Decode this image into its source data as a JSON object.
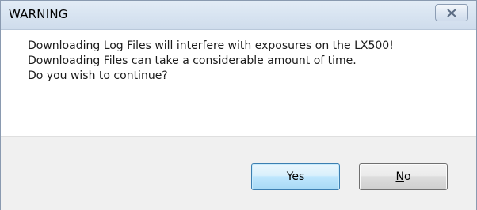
{
  "dialog": {
    "title": "WARNING",
    "message_lines": [
      "Downloading Log Files will interfere with exposures on the LX500!",
      "Downloading Files can take a considerable amount of time.",
      "Do you wish to continue?"
    ],
    "close_icon": "close-x-icon",
    "buttons": {
      "yes_label": "Yes",
      "no_mnemonic": "N",
      "no_rest": "o"
    }
  }
}
